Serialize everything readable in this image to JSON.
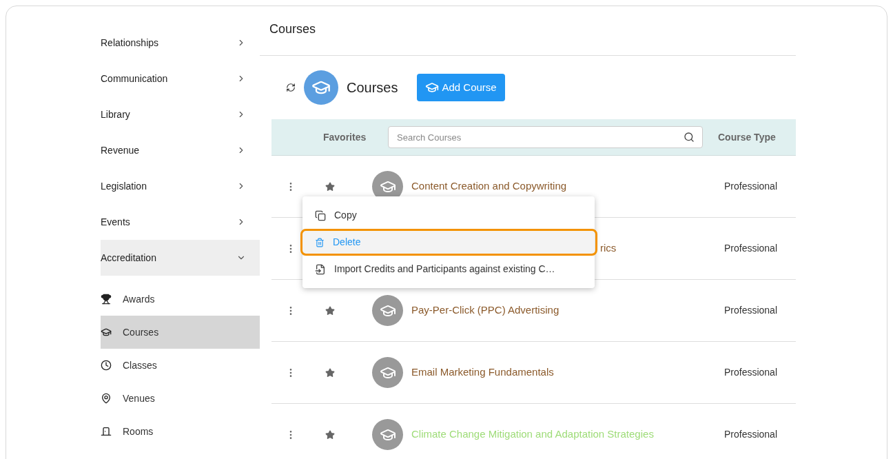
{
  "sidebar": {
    "sections": [
      {
        "label": "Relationships",
        "expanded": false
      },
      {
        "label": "Communication",
        "expanded": false
      },
      {
        "label": "Library",
        "expanded": false
      },
      {
        "label": "Revenue",
        "expanded": false
      },
      {
        "label": "Legislation",
        "expanded": false
      },
      {
        "label": "Events",
        "expanded": false
      },
      {
        "label": "Accreditation",
        "expanded": true,
        "children": [
          {
            "label": "Awards",
            "kind": "trophy",
            "selected": false
          },
          {
            "label": "Courses",
            "kind": "cap",
            "selected": true
          },
          {
            "label": "Classes",
            "kind": "clock",
            "selected": false
          },
          {
            "label": "Venues",
            "kind": "pin",
            "selected": false
          },
          {
            "label": "Rooms",
            "kind": "door",
            "selected": false
          }
        ]
      }
    ]
  },
  "page_title": "Courses",
  "toolbar": {
    "title": "Courses",
    "add_button": "Add Course"
  },
  "table": {
    "columns": [
      "Favorites",
      "Course Type"
    ],
    "search": {
      "placeholder": "Search Courses"
    },
    "rows": [
      {
        "title": "Content Creation and Copywriting",
        "color": "#8b5a2b",
        "type": "Professional"
      },
      {
        "title": "rics",
        "color": "#8b5a2b",
        "type": "Professional",
        "covered": true
      },
      {
        "title": "Pay-Per-Click (PPC) Advertising",
        "color": "#8b5a2b",
        "type": "Professional"
      },
      {
        "title": "Email Marketing Fundamentals",
        "color": "#8b5a2b",
        "type": "Professional"
      },
      {
        "title": "Climate Change Mitigation and Adaptation Strategies",
        "color": "#9edc78",
        "type": "Professional"
      }
    ]
  },
  "context_menu": {
    "items": [
      {
        "label": "Copy",
        "kind": "copy",
        "highlighted": false
      },
      {
        "label": "Delete",
        "kind": "delete",
        "highlighted": true
      },
      {
        "label": "Import Credits and Participants against existing C…",
        "kind": "import",
        "highlighted": false
      }
    ]
  }
}
